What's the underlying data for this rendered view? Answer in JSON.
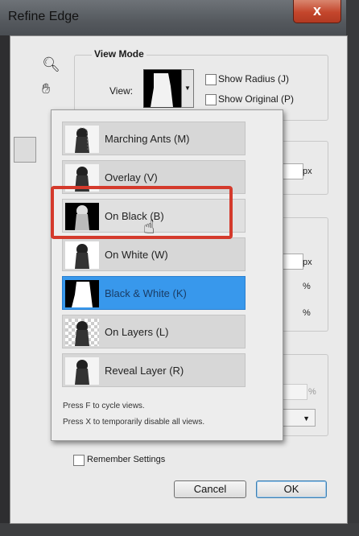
{
  "window": {
    "title": "Refine Edge",
    "close_glyph": "x"
  },
  "view_mode": {
    "group_title": "View Mode",
    "view_label": "View:",
    "show_radius_label": "Show Radius (J)",
    "show_original_label": "Show Original (P)"
  },
  "units": {
    "px1": "px",
    "px2": "px",
    "pct1": "%",
    "pct2": "%",
    "pct3": "%"
  },
  "dropdown": {
    "items": [
      {
        "label": "Marching Ants (M)",
        "icon": "marching-ants-thumb"
      },
      {
        "label": "Overlay (V)",
        "icon": "overlay-thumb"
      },
      {
        "label": "On Black (B)",
        "icon": "on-black-thumb"
      },
      {
        "label": "On White (W)",
        "icon": "on-white-thumb"
      },
      {
        "label": "Black & White (K)",
        "icon": "black-white-thumb"
      },
      {
        "label": "On Layers (L)",
        "icon": "on-layers-thumb"
      },
      {
        "label": "Reveal Layer (R)",
        "icon": "reveal-layer-thumb"
      }
    ],
    "hint1": "Press F to cycle views.",
    "hint2": "Press X to temporarily disable all views."
  },
  "remember_settings_label": "Remember Settings",
  "buttons": {
    "cancel": "Cancel",
    "ok": "OK"
  },
  "colors": {
    "selected": "#3898ec",
    "highlight_border": "#d43a2c"
  }
}
